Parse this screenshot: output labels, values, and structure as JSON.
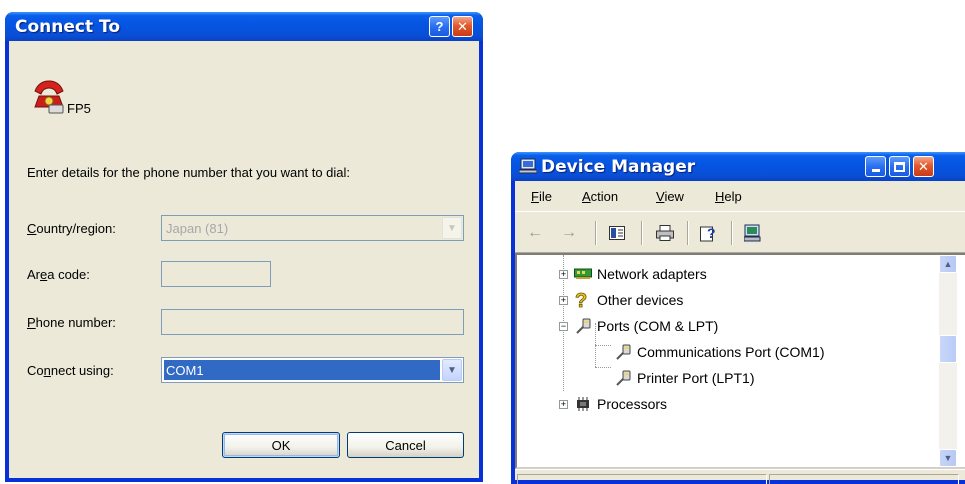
{
  "connect_dialog": {
    "title": "Connect To",
    "help_button": "?",
    "close_button": "✕",
    "connection_name": "FP5",
    "instructions": "Enter details for the phone number that you want to dial:",
    "country_label_pre": "",
    "country_label_key": "C",
    "country_label_post": "ountry/region:",
    "country_value": "Japan (81)",
    "area_label_pre": "Ar",
    "area_label_key": "e",
    "area_label_post": "a code:",
    "area_value": "",
    "phone_label_pre": "",
    "phone_label_key": "P",
    "phone_label_post": "hone number:",
    "phone_value": "",
    "connect_label_pre": "Co",
    "connect_label_key": "n",
    "connect_label_post": "nect using:",
    "connect_value": "COM1",
    "ok_label": "OK",
    "cancel_label": "Cancel"
  },
  "device_manager": {
    "title": "Device Manager",
    "menu": {
      "file_key": "F",
      "file_rest": "ile",
      "action_key": "A",
      "action_rest": "ction",
      "view_key": "V",
      "view_rest": "iew",
      "help_key": "H",
      "help_rest": "elp"
    },
    "tree": [
      {
        "label": "Network adapters",
        "icon": "network-adapter-icon",
        "expander": "+"
      },
      {
        "label": "Other devices",
        "icon": "unknown-device-icon",
        "expander": "+"
      },
      {
        "label": "Ports (COM & LPT)",
        "icon": "port-icon",
        "expander": "−"
      },
      {
        "label": "Communications Port (COM1)",
        "icon": "port-icon"
      },
      {
        "label": "Printer Port (LPT1)",
        "icon": "port-icon"
      },
      {
        "label": "Processors",
        "icon": "processor-icon",
        "expander": "+"
      }
    ]
  },
  "colors": {
    "title_blue": "#0554e3",
    "selection": "#316ac5",
    "close_red": "#e25a2f",
    "dialog_face": "#ece9d8"
  }
}
